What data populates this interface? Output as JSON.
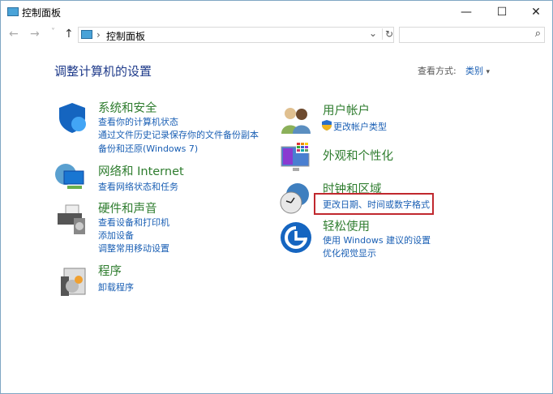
{
  "window": {
    "title": "控制面板",
    "minimize": "—",
    "maximize": "☐",
    "close": "✕"
  },
  "nav": {
    "back": "←",
    "forward": "→",
    "recent": "˅",
    "up": "↑",
    "breadcrumb_sep": "›",
    "breadcrumb": "控制面板",
    "dropdown": "⌄",
    "refresh": "↻",
    "search_placeholder": "",
    "search_icon": "⌕"
  },
  "main": {
    "title": "调整计算机的设置",
    "view_by_label": "查看方式:",
    "view_by_value": "类别",
    "view_by_arrow": "▾"
  },
  "categories": [
    {
      "heading": "系统和安全",
      "icon": "shield-icon",
      "links": [
        "查看你的计算机状态",
        "通过文件历史记录保存你的文件备份副本",
        "备份和还原(Windows 7)"
      ]
    },
    {
      "heading": "网络和 Internet",
      "icon": "network-icon",
      "links": [
        "查看网络状态和任务"
      ]
    },
    {
      "heading": "硬件和声音",
      "icon": "printer-icon",
      "links": [
        "查看设备和打印机",
        "添加设备",
        "调整常用移动设置"
      ]
    },
    {
      "heading": "程序",
      "icon": "programs-icon",
      "links": [
        "卸载程序"
      ]
    },
    {
      "heading": "用户帐户",
      "icon": "users-icon",
      "links": [
        "更改帐户类型"
      ]
    },
    {
      "heading": "外观和个性化",
      "icon": "appearance-icon",
      "links": []
    },
    {
      "heading": "时钟和区域",
      "icon": "clock-icon",
      "links": [
        "更改日期、时间或数字格式"
      ]
    },
    {
      "heading": "轻松使用",
      "icon": "ease-of-access-icon",
      "links": [
        "使用 Windows 建议的设置",
        "优化视觉显示"
      ]
    }
  ],
  "colors": {
    "heading": "#2f7d2f",
    "link": "#1a5fb4",
    "highlight": "#c0282e"
  }
}
